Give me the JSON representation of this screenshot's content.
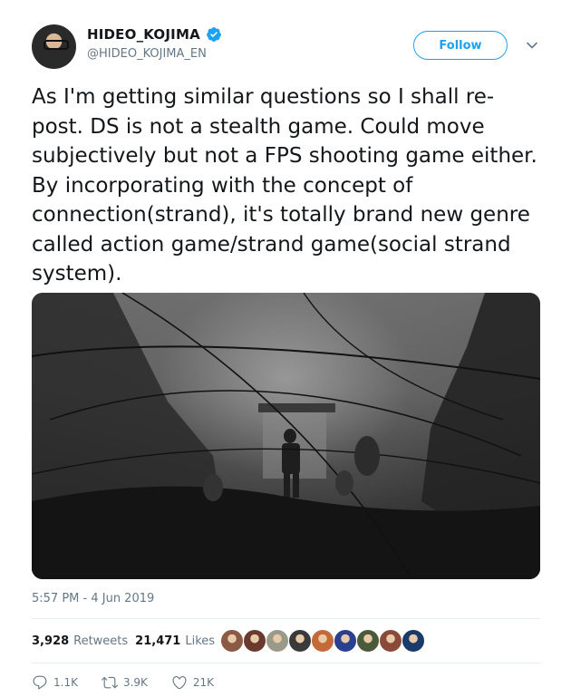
{
  "author": {
    "name": "HIDEO_KOJIMA",
    "handle": "@HIDEO_KOJIMA_EN",
    "verified": true
  },
  "follow_label": "Follow",
  "tweet_text": "As I'm getting similar questions so I shall re-post. DS is not a stealth game. Could move subjectively but not a FPS shooting game either. By incorporating with the concept of connection(strand), it's totally brand new genre called action game/strand game(social strand system).",
  "timestamp": "5:57 PM - 4 Jun 2019",
  "stats": {
    "retweets_count": "3,928",
    "retweets_label": "Retweets",
    "likes_count": "21,471",
    "likes_label": "Likes"
  },
  "liker_avatars": [
    "#8a5a44",
    "#6b3a2f",
    "#9a9a8a",
    "#3a3a3a",
    "#c46a3a",
    "#2b3f8f",
    "#4a5a3a",
    "#8a4a3a",
    "#1a3a6a"
  ],
  "actions": {
    "replies": "1.1K",
    "retweets": "3.9K",
    "likes": "21K"
  },
  "colors": {
    "accent": "#1da1f2",
    "secondary_text": "#657786",
    "primary_text": "#14171a"
  }
}
